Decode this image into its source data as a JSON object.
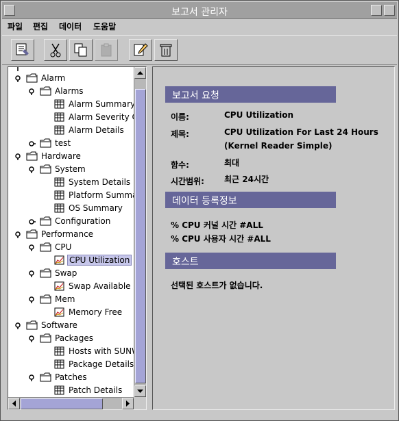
{
  "window": {
    "title": "보고서 관리자"
  },
  "menu": {
    "items": [
      "파일",
      "편집",
      "데이터",
      "도움말"
    ]
  },
  "toolbar": {
    "buttons": [
      {
        "name": "new-report-icon"
      },
      {
        "name": "cut-icon"
      },
      {
        "name": "copy-icon"
      },
      {
        "name": "paste-icon",
        "disabled": true
      },
      {
        "name": "edit-icon"
      },
      {
        "name": "delete-icon"
      }
    ]
  },
  "tree": {
    "nodes": [
      {
        "label": "Alarm",
        "level": 0,
        "type": "folder",
        "expanded": true
      },
      {
        "label": "Alarms",
        "level": 1,
        "type": "folder",
        "expanded": true
      },
      {
        "label": "Alarm Summary",
        "level": 2,
        "type": "table"
      },
      {
        "label": "Alarm Severity Co",
        "level": 2,
        "type": "table"
      },
      {
        "label": "Alarm Details",
        "level": 2,
        "type": "table"
      },
      {
        "label": "test",
        "level": 1,
        "type": "folder"
      },
      {
        "label": "Hardware",
        "level": 0,
        "type": "folder",
        "expanded": true
      },
      {
        "label": "System",
        "level": 1,
        "type": "folder",
        "expanded": true
      },
      {
        "label": "System Details",
        "level": 2,
        "type": "table"
      },
      {
        "label": "Platform Summary",
        "level": 2,
        "type": "table"
      },
      {
        "label": "OS Summary",
        "level": 2,
        "type": "table"
      },
      {
        "label": "Configuration",
        "level": 1,
        "type": "folder",
        "expanded": false
      },
      {
        "label": "Performance",
        "level": 0,
        "type": "folder",
        "expanded": true
      },
      {
        "label": "CPU",
        "level": 1,
        "type": "folder",
        "expanded": true
      },
      {
        "label": "CPU Utilization",
        "level": 2,
        "type": "chart",
        "selected": true
      },
      {
        "label": "Swap",
        "level": 1,
        "type": "folder",
        "expanded": true
      },
      {
        "label": "Swap Available",
        "level": 2,
        "type": "chart"
      },
      {
        "label": "Mem",
        "level": 1,
        "type": "folder",
        "expanded": true
      },
      {
        "label": "Memory Free",
        "level": 2,
        "type": "chart"
      },
      {
        "label": "Software",
        "level": 0,
        "type": "folder",
        "expanded": true
      },
      {
        "label": "Packages",
        "level": 1,
        "type": "folder",
        "expanded": true
      },
      {
        "label": "Hosts with SUNW",
        "level": 2,
        "type": "table"
      },
      {
        "label": "Package Details",
        "level": 2,
        "type": "table"
      },
      {
        "label": "Patches",
        "level": 1,
        "type": "folder",
        "expanded": true
      },
      {
        "label": "Patch Details",
        "level": 2,
        "type": "table"
      }
    ]
  },
  "details": {
    "request_header": "보고서 요청",
    "name_label": "이름:",
    "name_value": "CPU Utilization",
    "title_label": "제목:",
    "title_value": "CPU Utilization For Last 24 Hours (Kernel Reader Simple)",
    "function_label": "함수:",
    "function_value": "최대",
    "timerange_label": "시간범위:",
    "timerange_value": "최근 24시간",
    "data_header": "데이터 등록정보",
    "data_items": [
      "% CPU 커널 시간 #ALL",
      "% CPU 사용자 시간 #ALL"
    ],
    "host_header": "호스트",
    "host_message": "선택된 호스트가 없습니다."
  },
  "colors": {
    "section_header": "#666699",
    "selection": "#c6c6ea",
    "scroll_thumb": "#a4a4d6"
  }
}
